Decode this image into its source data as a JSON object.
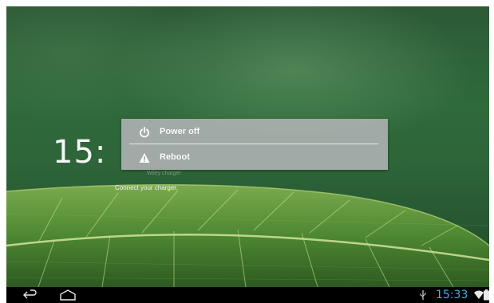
{
  "lockscreen": {
    "clock": "15:",
    "charger_ghost": "Wiley charger",
    "charger_message": "Connect your charger."
  },
  "power_dialog": {
    "items": [
      {
        "label": "Power off",
        "icon": "power-icon"
      },
      {
        "label": "Reboot",
        "icon": "warning-icon"
      }
    ]
  },
  "navbar": {
    "buttons": [
      "back-icon",
      "home-icon"
    ],
    "status_icons": [
      "usb-icon",
      "wifi-icon",
      "battery-icon"
    ],
    "time": "15:33",
    "time_color": "#3fb7e8"
  },
  "colors": {
    "dialog_bg": "#aaafae",
    "wallpaper": "#2e6539"
  }
}
